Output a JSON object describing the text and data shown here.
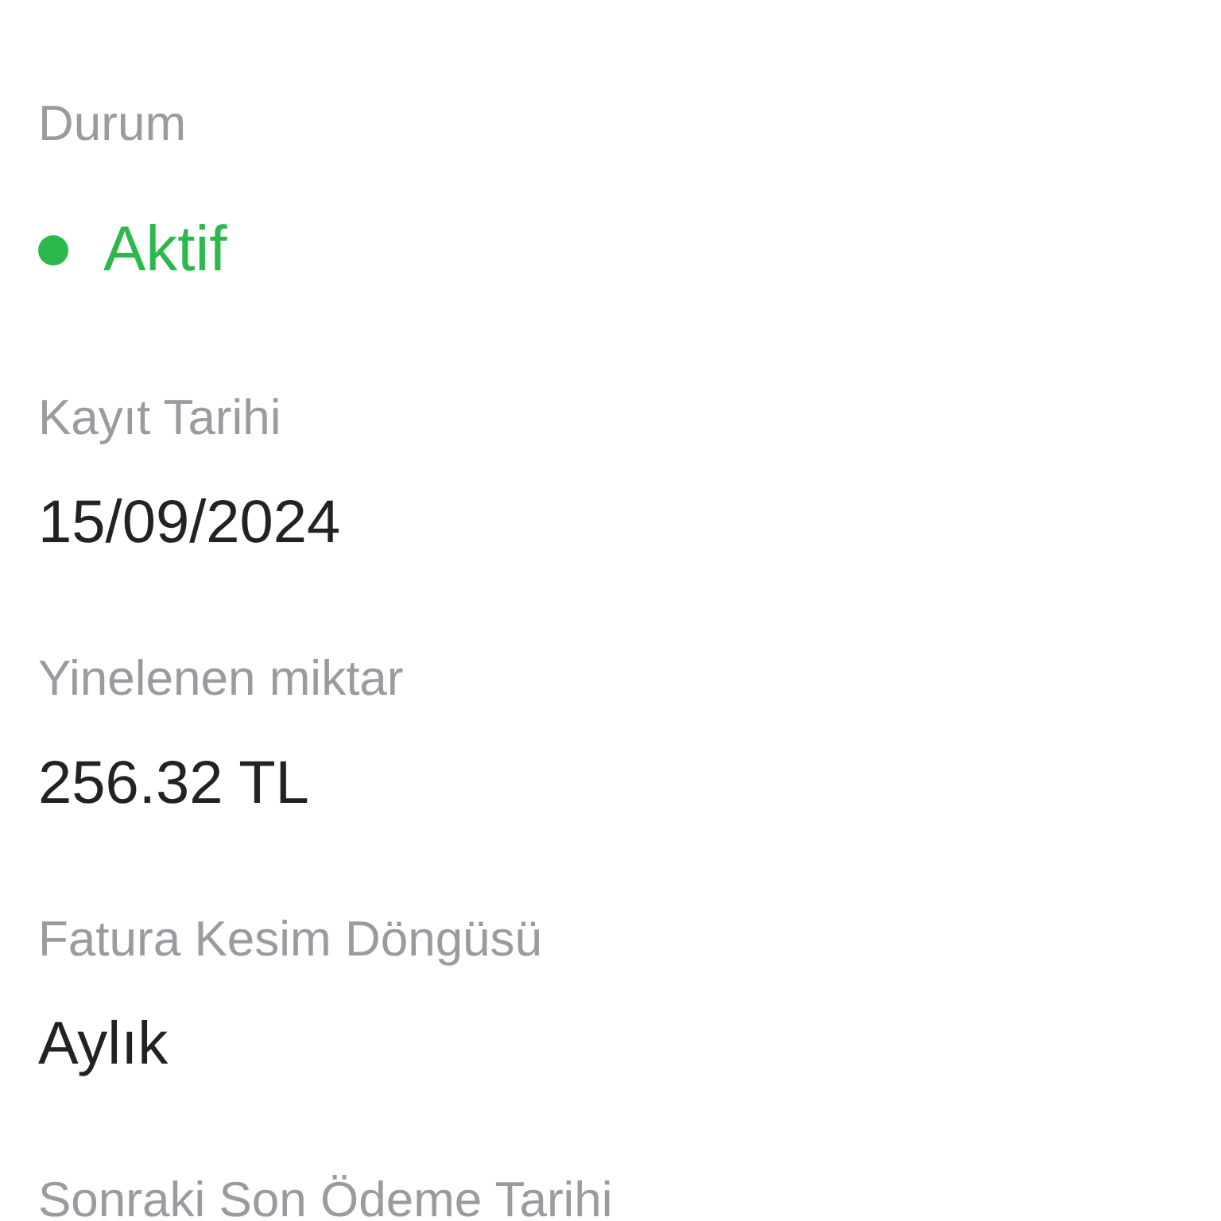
{
  "fields": [
    {
      "kind": "status",
      "label": "Durum",
      "value": "Aktif",
      "color": "#2db84c"
    },
    {
      "kind": "text",
      "label": "Kayıt Tarihi",
      "value": "15/09/2024"
    },
    {
      "kind": "text",
      "label": "Yinelenen miktar",
      "value": "256.32 TL"
    },
    {
      "kind": "text",
      "label": "Fatura Kesim Döngüsü",
      "value": "Aylık"
    },
    {
      "kind": "label_only",
      "label": "Sonraki Son Ödeme Tarihi"
    }
  ]
}
